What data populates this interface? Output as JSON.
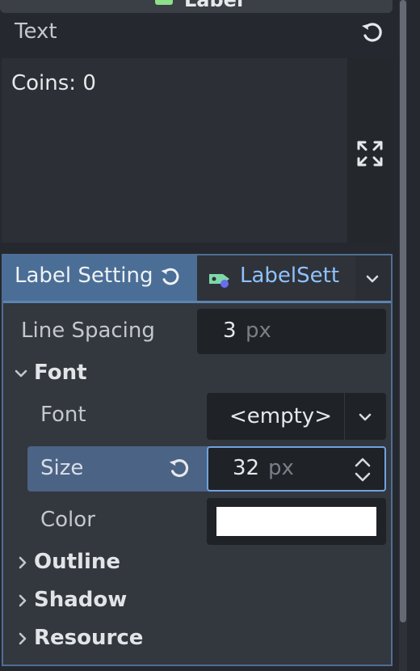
{
  "header": {
    "label": "Label",
    "icon": "label-node-icon",
    "icon_color": "#8fe08a"
  },
  "text_property": {
    "label": "Text",
    "value": "Coins: 0",
    "revert_icon": "revert-icon",
    "expand_icon": "expand-icon"
  },
  "subresource": {
    "active_tab_label": "Label Setting",
    "resource_label": "LabelSett",
    "resource_icon": "label-settings-icon",
    "accent": "#4b6e96",
    "resource_text_color": "#8ec2ff"
  },
  "properties": {
    "line_spacing": {
      "label": "Line Spacing",
      "value": "3",
      "unit": "px"
    },
    "font_section": {
      "label": "Font"
    },
    "font": {
      "label": "Font",
      "value": "<empty>"
    },
    "size": {
      "label": "Size",
      "value": "32",
      "unit": "px"
    },
    "color": {
      "label": "Color",
      "swatch": "#ffffff"
    },
    "outline_section": {
      "label": "Outline"
    },
    "shadow_section": {
      "label": "Shadow"
    },
    "resource_section": {
      "label": "Resource"
    }
  }
}
